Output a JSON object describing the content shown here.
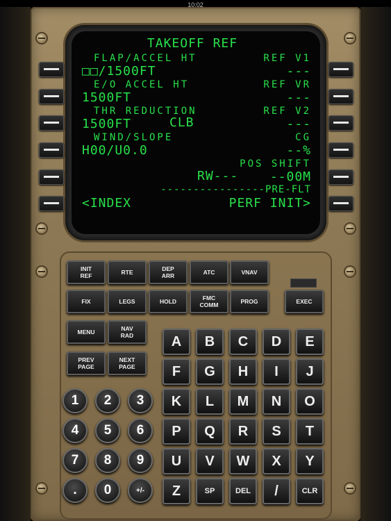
{
  "status_bar": {
    "time": "10:02"
  },
  "screen": {
    "title": "TAKEOFF REF",
    "lines": [
      {
        "left": "FLAP/ACCEL HT",
        "right": "REF V1"
      },
      {
        "left": "□□/1500FT",
        "right": "---"
      },
      {
        "left": "E/O ACCEL HT",
        "right": "REF VR"
      },
      {
        "left": "1500FT",
        "right": "---"
      },
      {
        "left": "THR REDUCTION",
        "right": "REF V2"
      },
      {
        "left": "1500FT",
        "mid": "CLB",
        "right": "---"
      },
      {
        "left": "WIND/SLOPE",
        "right": "CG"
      },
      {
        "left": "H00/U0.0",
        "right": "--%"
      },
      {
        "right": "POS SHIFT"
      },
      {
        "mid": "RW---",
        "right": "--00M"
      },
      {
        "sep": "----------------PRE-FLT"
      },
      {
        "left": "<INDEX",
        "right": "PERF INIT>"
      }
    ]
  },
  "function_keys": [
    {
      "label": "INIT\nREF"
    },
    {
      "label": "RTE"
    },
    {
      "label": "DEP\nARR"
    },
    {
      "label": "ATC"
    },
    {
      "label": "VNAV"
    },
    {
      "label": "FIX"
    },
    {
      "label": "LEGS"
    },
    {
      "label": "HOLD"
    },
    {
      "label": "FMC\nCOMM"
    },
    {
      "label": "PROG"
    },
    {
      "label": "EXEC"
    },
    {
      "label": "MENU"
    },
    {
      "label": "NAV\nRAD"
    },
    {
      "label": "PREV\nPAGE"
    },
    {
      "label": "NEXT\nPAGE"
    }
  ],
  "alpha_keys": [
    "A",
    "B",
    "C",
    "D",
    "E",
    "F",
    "G",
    "H",
    "I",
    "J",
    "K",
    "L",
    "M",
    "N",
    "O",
    "P",
    "Q",
    "R",
    "S",
    "T",
    "U",
    "V",
    "W",
    "X",
    "Y",
    "Z",
    "SP",
    "DEL",
    "/",
    "CLR"
  ],
  "numeric_keys": [
    "1",
    "2",
    "3",
    "4",
    "5",
    "6",
    "7",
    "8",
    "9",
    ".",
    "0",
    "+/-"
  ]
}
